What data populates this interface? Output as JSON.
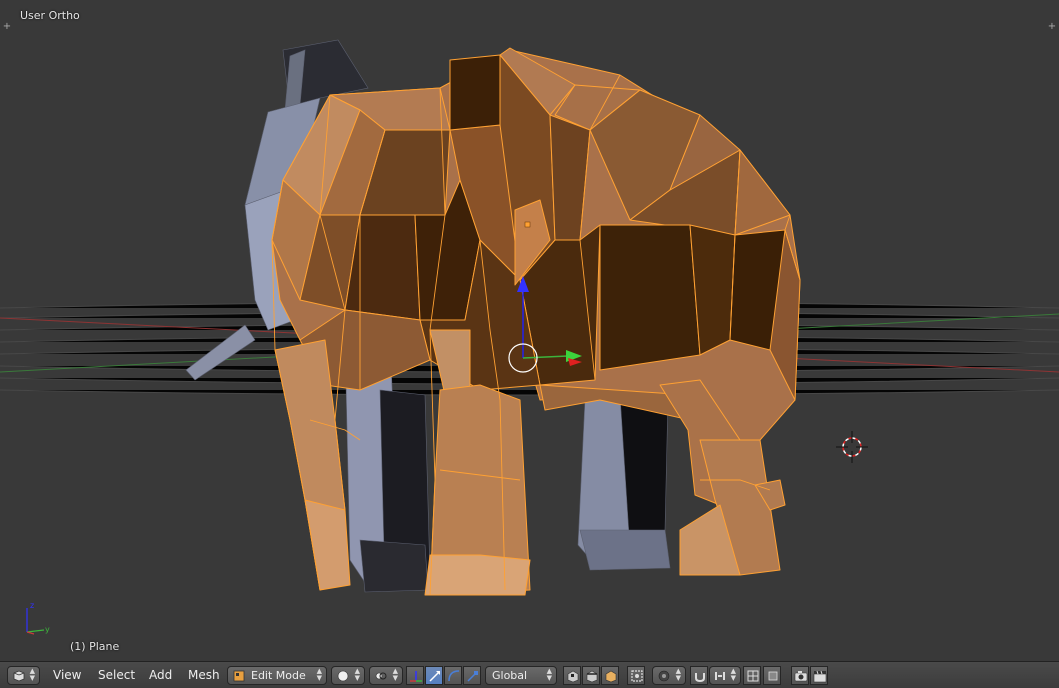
{
  "viewport": {
    "view_title": "User Ortho",
    "object_info": "(1) Plane"
  },
  "header": {
    "menus": [
      "View",
      "Select",
      "Add",
      "Mesh"
    ],
    "mode": "Edit Mode",
    "orientation": "Global"
  },
  "colors": {
    "viewport_bg": "#393939",
    "selection": "#ffa133",
    "x_axis": "#c83c3c",
    "y_axis": "#3cb43c",
    "z_axis": "#3232ff"
  },
  "icons": [
    "editor-type-icon",
    "viewport-shading-icon",
    "pivot-point-icon",
    "manipulator-icon",
    "translate-icon",
    "rotate-icon",
    "scale-icon",
    "vertex-select-icon",
    "edge-select-icon",
    "face-select-icon",
    "limit-selection-icon",
    "proportional-edit-icon",
    "snap-icon",
    "snap-target-icon",
    "render-icon",
    "animation-render-icon"
  ]
}
